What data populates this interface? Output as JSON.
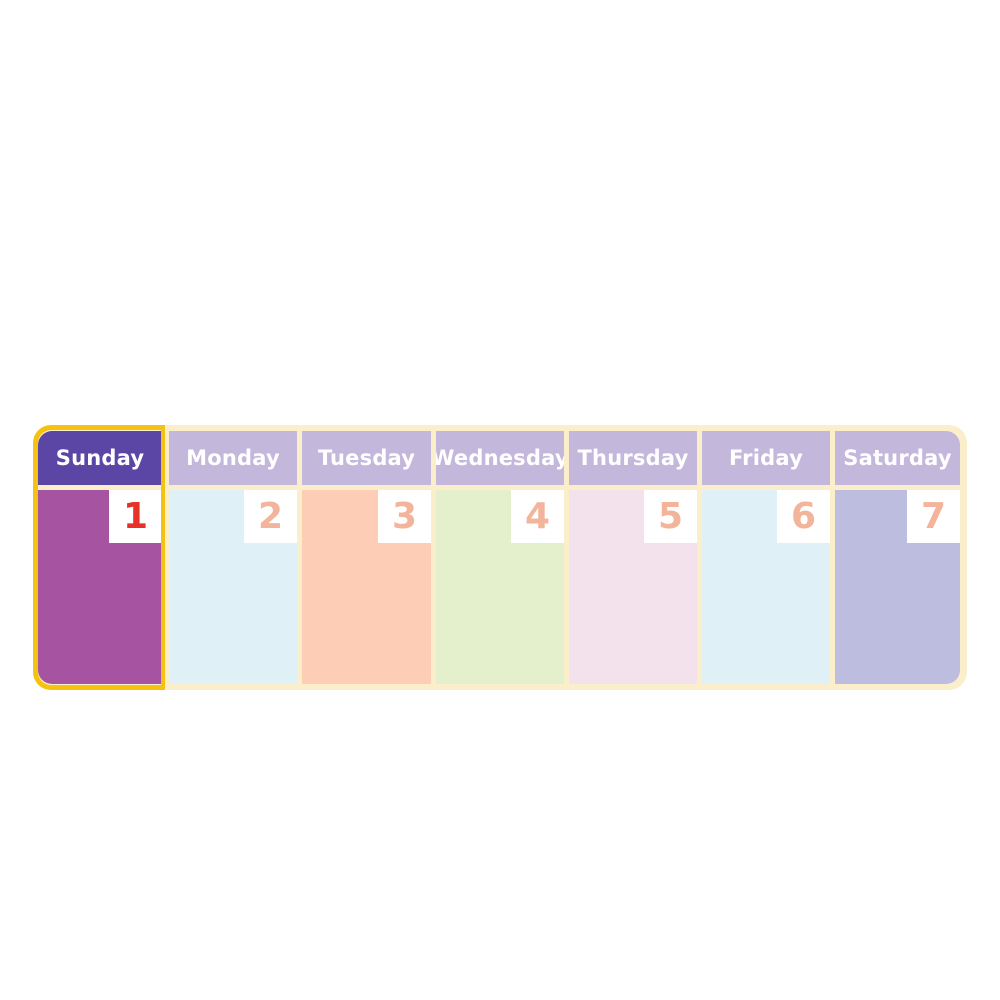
{
  "calendar": {
    "days": [
      {
        "name": "Sunday",
        "date": "1",
        "header_color": "#5b46a6",
        "body_color": "#a653a1",
        "date_color": "#e63028"
      },
      {
        "name": "Monday",
        "date": "2",
        "header_color": "#c3b7dc",
        "body_color": "#dff0f7",
        "date_color": "#f2b49a"
      },
      {
        "name": "Tuesday",
        "date": "3",
        "header_color": "#c3b7dc",
        "body_color": "#fecdb6",
        "date_color": "#f2b49a"
      },
      {
        "name": "Wednesday",
        "date": "4",
        "header_color": "#c3b7dc",
        "body_color": "#e4efcb",
        "date_color": "#f2b49a"
      },
      {
        "name": "Thursday",
        "date": "5",
        "header_color": "#c3b7dc",
        "body_color": "#f3e1eb",
        "date_color": "#f2b49a"
      },
      {
        "name": "Friday",
        "date": "6",
        "header_color": "#c3b7dc",
        "body_color": "#dff0f7",
        "date_color": "#f2b49a"
      },
      {
        "name": "Saturday",
        "date": "7",
        "header_color": "#c3b7dc",
        "body_color": "#bdbde0",
        "date_color": "#f2b49a"
      }
    ],
    "frame_color": "#fbeeca",
    "highlight_color": "#f5c214"
  }
}
